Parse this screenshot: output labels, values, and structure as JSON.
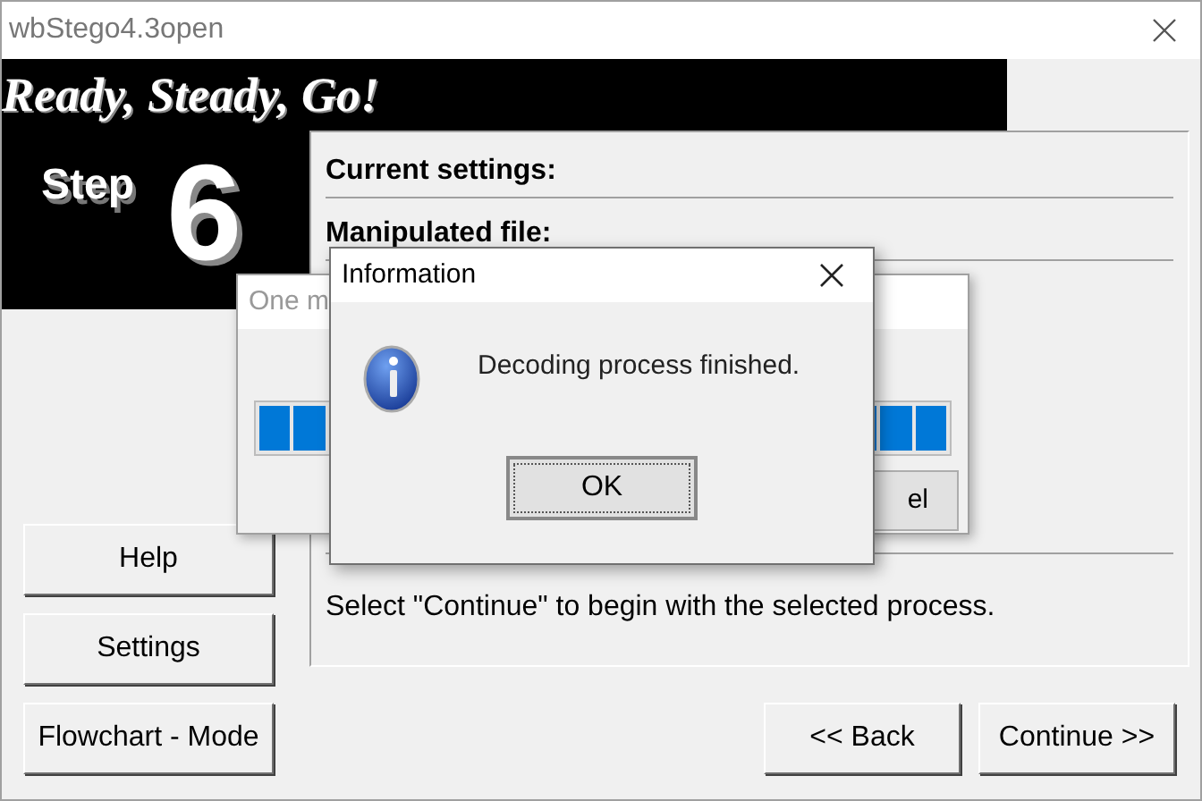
{
  "window": {
    "title": "wbStego4.3open"
  },
  "banner": {
    "heading": "Ready, Steady, Go!",
    "step_label": "Step",
    "step_number": "6"
  },
  "settings_panel": {
    "sections": [
      "Current settings:",
      "Manipulated file:"
    ],
    "instruction": "Select \"Continue\" to begin with the selected process."
  },
  "side_buttons": [
    "Help",
    "Settings",
    "Flowchart - Mode"
  ],
  "nav_buttons": [
    "<< Back",
    "Continue >>"
  ],
  "progress_dialog": {
    "title": "One m",
    "cancel_button": "el"
  },
  "info_dialog": {
    "title": "Information",
    "message": "Decoding process finished.",
    "ok_button": "OK"
  }
}
